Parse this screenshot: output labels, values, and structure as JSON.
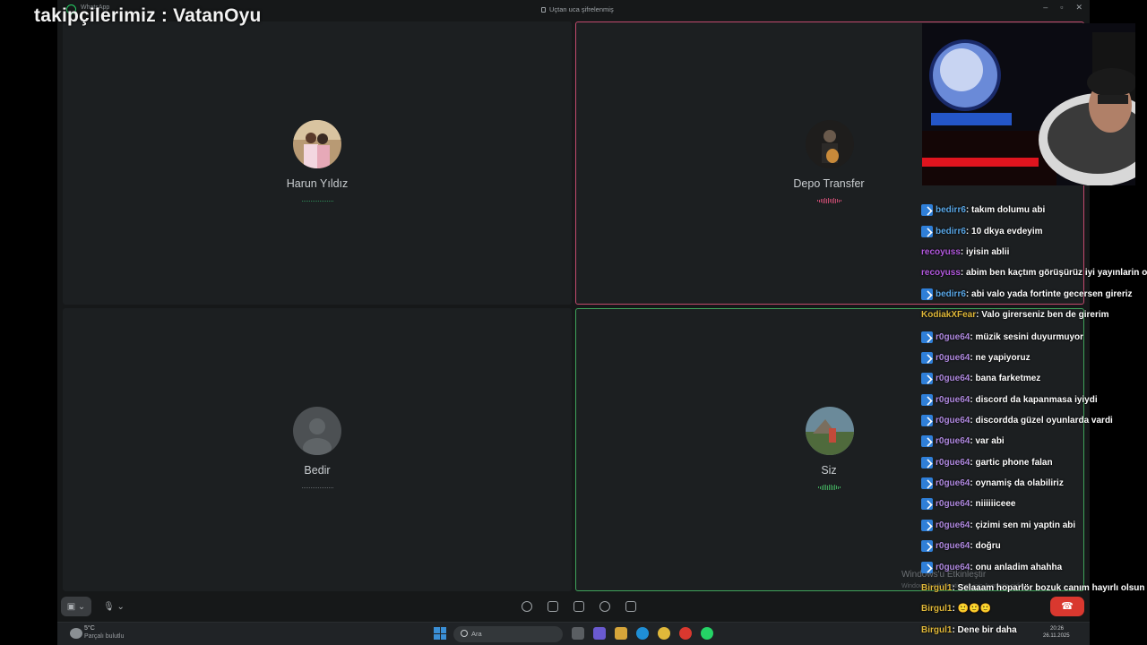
{
  "window": {
    "app_name": "WhatsApp",
    "encryption_text": "Uçtan uca şifrelenmiş",
    "controls": [
      "–",
      "▫",
      "✕"
    ]
  },
  "overlay": {
    "text": "takipçilerimiz : VatanOyu"
  },
  "participants": [
    {
      "name": "Harun Yıldız",
      "speaking": false
    },
    {
      "name": "Depo Transfer",
      "speaking": true,
      "color": "#c24a6e"
    },
    {
      "name": "Bedir",
      "speaking": false
    },
    {
      "name": "Siz",
      "speaking": true,
      "color": "#3fa35a"
    }
  ],
  "controls": {
    "camera_label": "▣ ⌄",
    "mic_label": "🎙 ⌄",
    "hangup_label": "☎"
  },
  "activation": {
    "title": "Windows'u Etkinleştir",
    "subtitle": "Windows'u etkinleştirmek için Ayarlar'a gidin."
  },
  "taskbar": {
    "temp": "5°C",
    "weather": "Parçalı bulutlu",
    "search_placeholder": "Ara",
    "time": "20:26",
    "date": "26.11.2025"
  },
  "chat": [
    {
      "user": "bedirr6",
      "text": ": takım dolumu abi",
      "color": "#5aa8e8",
      "badge": true
    },
    {
      "user": "bedirr6",
      "text": ": 10 dkya evdeyim",
      "color": "#5aa8e8",
      "badge": true
    },
    {
      "user": "recoyuss",
      "text": ": iyisin ablii",
      "color": "#b45be0",
      "badge": false
    },
    {
      "user": "recoyuss",
      "text": ": abim ben kaçtım görüşürüz iyi yayınlarin olsun",
      "color": "#b45be0",
      "badge": false
    },
    {
      "user": "bedirr6",
      "text": ": abi valo yada fortinte gecersen gireriz",
      "color": "#5aa8e8",
      "badge": true
    },
    {
      "user": "KodiakXFear",
      "text": ": Valo girerseniz ben de girerim",
      "color": "#e0b83a",
      "badge": false
    },
    {
      "user": "r0gue64",
      "text": ": müzik sesini duyurmuyor",
      "color": "#b08ae0",
      "badge": true
    },
    {
      "user": "r0gue64",
      "text": ": ne yapiyoruz",
      "color": "#b08ae0",
      "badge": true
    },
    {
      "user": "r0gue64",
      "text": ": bana farketmez",
      "color": "#b08ae0",
      "badge": true
    },
    {
      "user": "r0gue64",
      "text": ": discord da kapanmasa iyiydi",
      "color": "#b08ae0",
      "badge": true
    },
    {
      "user": "r0gue64",
      "text": ": discordda güzel oyunlarda vardi",
      "color": "#b08ae0",
      "badge": true
    },
    {
      "user": "r0gue64",
      "text": ": var abi",
      "color": "#b08ae0",
      "badge": true
    },
    {
      "user": "r0gue64",
      "text": ": gartic phone falan",
      "color": "#b08ae0",
      "badge": true
    },
    {
      "user": "r0gue64",
      "text": ": oynamiş da olabiliriz",
      "color": "#b08ae0",
      "badge": true
    },
    {
      "user": "r0gue64",
      "text": ": niiiiiiceee",
      "color": "#b08ae0",
      "badge": true
    },
    {
      "user": "r0gue64",
      "text": ": çizimi sen mi yaptin abi",
      "color": "#b08ae0",
      "badge": true
    },
    {
      "user": "r0gue64",
      "text": ": doğru",
      "color": "#b08ae0",
      "badge": true
    },
    {
      "user": "r0gue64",
      "text": ": onu anladim ahahha",
      "color": "#b08ae0",
      "badge": true
    },
    {
      "user": "Birgul1",
      "text": ": Selaaam hoparlör bozuk canım hayırlı olsun",
      "color": "#e0b83a",
      "badge": false
    },
    {
      "user": "Birgul1",
      "text": ": 🙂🙂🙂",
      "color": "#e0b83a",
      "badge": false
    },
    {
      "user": "Birgul1",
      "text": ": Dene bir daha",
      "color": "#e0b83a",
      "badge": false
    }
  ]
}
